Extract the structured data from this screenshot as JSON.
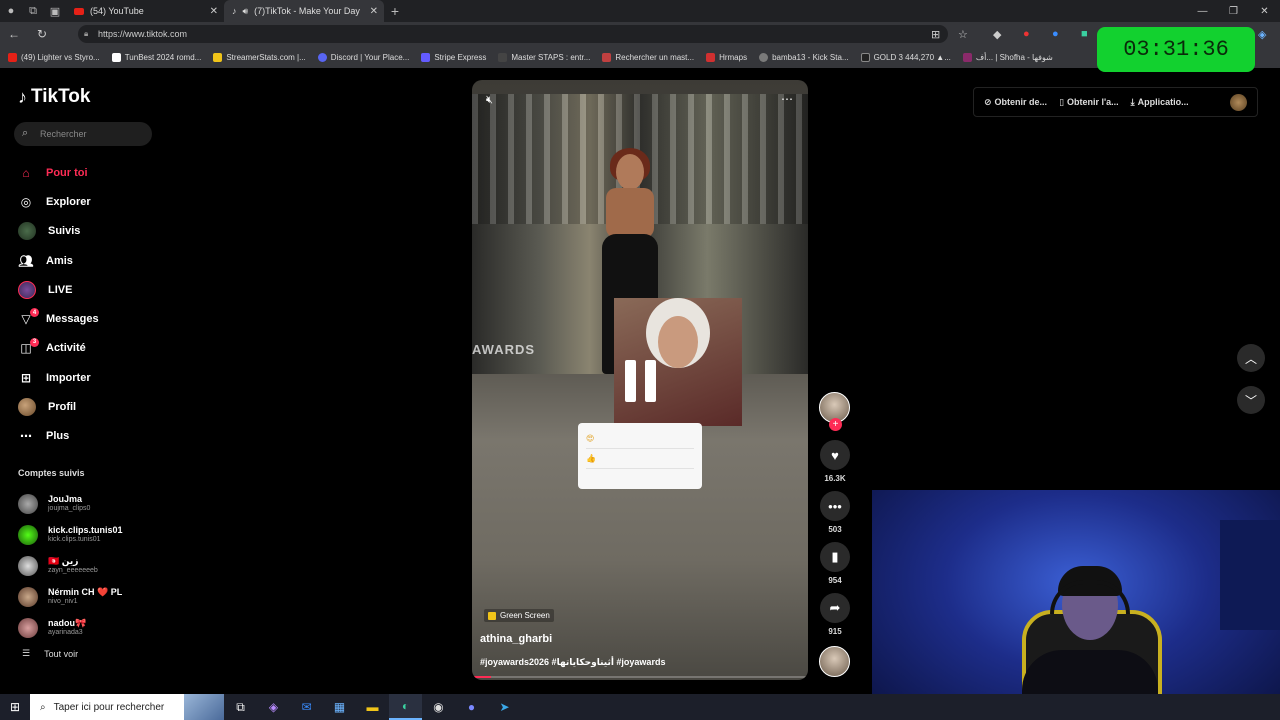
{
  "browser": {
    "tabs": [
      {
        "title": "(54) YouTube"
      },
      {
        "title": "(7)TikTok - Make Your Day"
      }
    ],
    "url": "https://www.tiktok.com",
    "bookmarks": [
      {
        "label": "(49) Lighter vs Styro...",
        "color": "#e62117"
      },
      {
        "label": "TunBest 2024 romd...",
        "color": "#ffffff"
      },
      {
        "label": "StreamerStats.com |...",
        "color": "#f0c419"
      },
      {
        "label": "Discord | Your Place...",
        "color": "#5865f2"
      },
      {
        "label": "Stripe Express",
        "color": "#635bff"
      },
      {
        "label": "Master STAPS : entr...",
        "color": "#444444"
      },
      {
        "label": "Rechercher un mast...",
        "color": "#c04040"
      },
      {
        "label": "Hrmaps",
        "color": "#d03030"
      },
      {
        "label": "bamba13 - Kick Sta...",
        "color": "#7a7a7a"
      },
      {
        "label": "GOLD 3 444,270 ▲...",
        "color": "#222222"
      },
      {
        "label": "أف... | Shofha - شوفها",
        "color": "#8a2a6a"
      }
    ]
  },
  "timer": "03:31:36",
  "tiktok": {
    "logo": "TikTok",
    "search_placeholder": "Rechercher",
    "nav": [
      {
        "label": "Pour toi",
        "icon": "home-icon"
      },
      {
        "label": "Explorer",
        "icon": "compass-icon"
      },
      {
        "label": "Suivis",
        "icon": "following-icon"
      },
      {
        "label": "Amis",
        "icon": "friends-icon"
      },
      {
        "label": "LIVE",
        "icon": "live-icon"
      },
      {
        "label": "Messages",
        "icon": "messages-icon",
        "badge": "4"
      },
      {
        "label": "Activité",
        "icon": "activity-icon",
        "badge": "3"
      },
      {
        "label": "Importer",
        "icon": "upload-icon"
      },
      {
        "label": "Profil",
        "icon": "profile-icon"
      },
      {
        "label": "Plus",
        "icon": "more-icon"
      }
    ],
    "following_title": "Comptes suivis",
    "following": [
      {
        "name": "JouJma",
        "user": "joujma_clips0"
      },
      {
        "name": "kick.clips.tunis01",
        "user": "kick.clips.tunis01"
      },
      {
        "name": "🇹🇳 زين",
        "user": "zayn_eeeeeeeb"
      },
      {
        "name": "Nérmin CH ❤️ PL",
        "user": "nivo_niv1"
      },
      {
        "name": "nadou🎀",
        "user": "ayarinada3"
      }
    ],
    "see_all": "Tout voir",
    "top": {
      "item1": "Obtenir de...",
      "item2": "Obtenir l'a...",
      "item3": "Applicatio..."
    },
    "video": {
      "awards_text": "AWARDS",
      "effect": "Green Screen",
      "author": "athina_gharbi",
      "caption": "#joyawards2026 #أثيناوحكاياتها #joyawards",
      "progress": 0.05,
      "popup_items": [
        "😍",
        "👍"
      ]
    },
    "actions": {
      "likes": "16.3K",
      "comments": "503",
      "saves": "954",
      "shares": "915"
    }
  },
  "taskbar": {
    "search_placeholder": "Taper ici pour rechercher"
  }
}
